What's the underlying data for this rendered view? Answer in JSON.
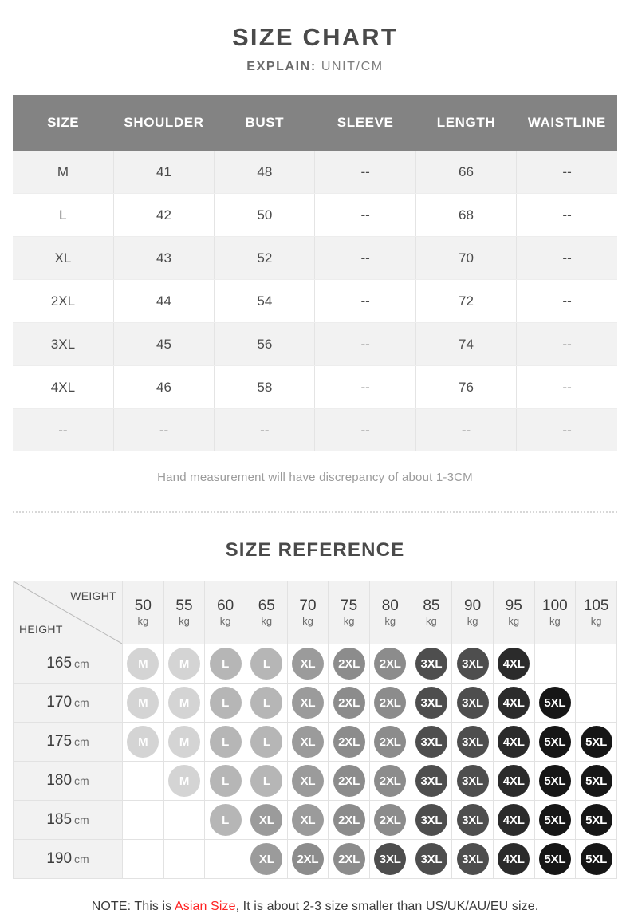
{
  "header": {
    "title": "SIZE CHART",
    "explain_label": "EXPLAIN:",
    "explain_value": "UNIT/CM"
  },
  "size_chart": {
    "columns": [
      "SIZE",
      "SHOULDER",
      "BUST",
      "SLEEVE",
      "LENGTH",
      "WAISTLINE"
    ],
    "rows": [
      [
        "M",
        "41",
        "48",
        "--",
        "66",
        "--"
      ],
      [
        "L",
        "42",
        "50",
        "--",
        "68",
        "--"
      ],
      [
        "XL",
        "43",
        "52",
        "--",
        "70",
        "--"
      ],
      [
        "2XL",
        "44",
        "54",
        "--",
        "72",
        "--"
      ],
      [
        "3XL",
        "45",
        "56",
        "--",
        "74",
        "--"
      ],
      [
        "4XL",
        "46",
        "58",
        "--",
        "76",
        "--"
      ],
      [
        "--",
        "--",
        "--",
        "--",
        "--",
        "--"
      ]
    ],
    "footnote": "Hand measurement will have discrepancy of about 1-3CM"
  },
  "size_reference": {
    "title": "SIZE REFERENCE",
    "weight_label": "WEIGHT",
    "height_label": "HEIGHT",
    "weight_unit": "kg",
    "height_unit": "cm",
    "weights": [
      "50",
      "55",
      "60",
      "65",
      "70",
      "75",
      "80",
      "85",
      "90",
      "95",
      "100",
      "105"
    ],
    "heights": [
      "165",
      "170",
      "175",
      "180",
      "185",
      "190"
    ],
    "grid": [
      [
        "M",
        "M",
        "L",
        "L",
        "XL",
        "2XL",
        "2XL",
        "3XL",
        "3XL",
        "4XL",
        "",
        ""
      ],
      [
        "M",
        "M",
        "L",
        "L",
        "XL",
        "2XL",
        "2XL",
        "3XL",
        "3XL",
        "4XL",
        "5XL",
        ""
      ],
      [
        "M",
        "M",
        "L",
        "L",
        "XL",
        "2XL",
        "2XL",
        "3XL",
        "3XL",
        "4XL",
        "5XL",
        "5XL"
      ],
      [
        "",
        "M",
        "L",
        "L",
        "XL",
        "2XL",
        "2XL",
        "3XL",
        "3XL",
        "4XL",
        "5XL",
        "5XL"
      ],
      [
        "",
        "",
        "L",
        "XL",
        "XL",
        "2XL",
        "2XL",
        "3XL",
        "3XL",
        "4XL",
        "5XL",
        "5XL"
      ],
      [
        "",
        "",
        "",
        "XL",
        "2XL",
        "2XL",
        "3XL",
        "3XL",
        "3XL",
        "4XL",
        "5XL",
        "5XL"
      ]
    ]
  },
  "note": {
    "prefix": "NOTE: This is ",
    "highlight": "Asian Size",
    "suffix": ", It is about 2-3 size smaller than US/UK/AU/EU size."
  },
  "colors": {
    "header_bg": "#838383",
    "row_alt_bg": "#f2f2f2",
    "badge_M": "#d4d4d4",
    "badge_L": "#b6b6b6",
    "badge_XL": "#9b9b9b",
    "badge_2XL": "#8c8c8c",
    "badge_3XL": "#4e4e4e",
    "badge_4XL": "#2b2b2b",
    "badge_5XL": "#161616",
    "highlight": "#ff2222"
  }
}
